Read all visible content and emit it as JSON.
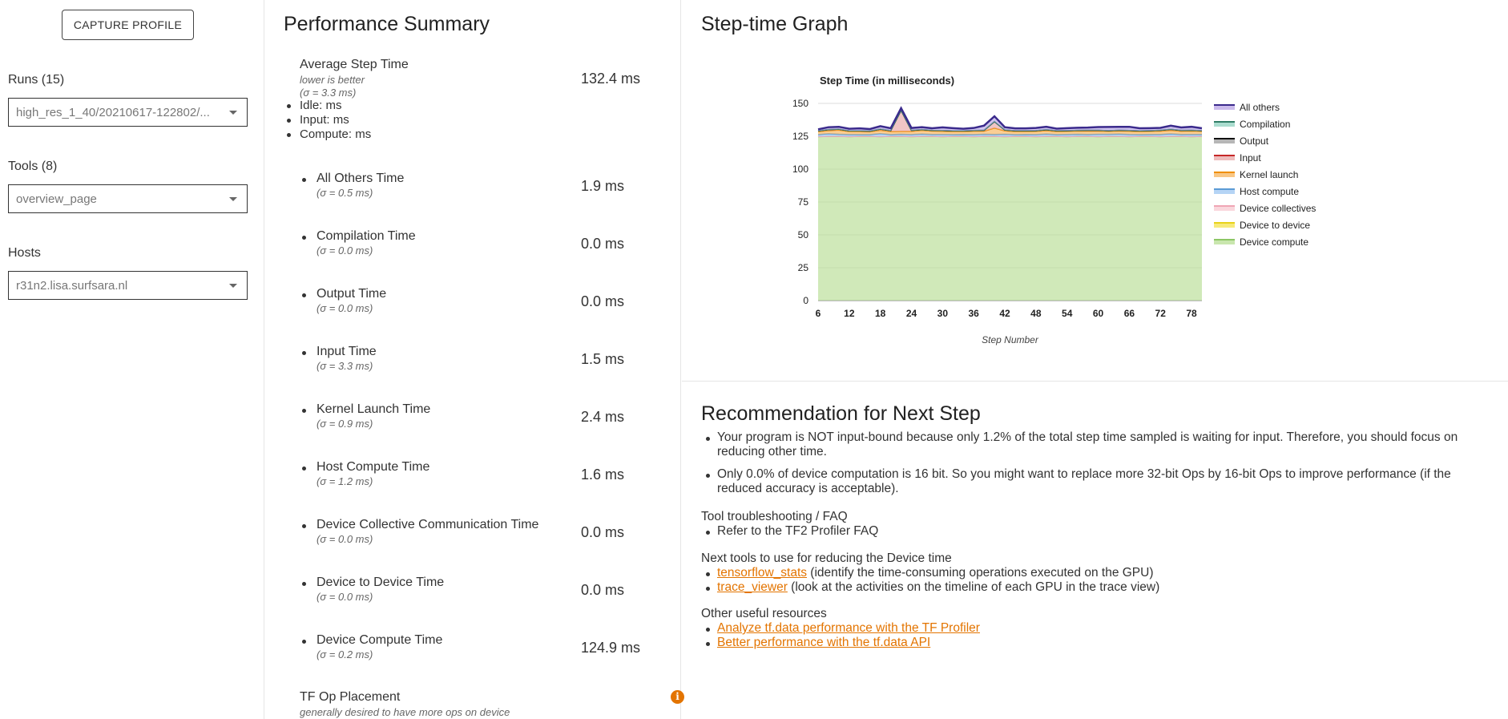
{
  "sidebar": {
    "capture_label": "CAPTURE PROFILE",
    "runs_label": "Runs (15)",
    "runs_value": "high_res_1_40/20210617-122802/...",
    "tools_label": "Tools (8)",
    "tools_value": "overview_page",
    "hosts_label": "Hosts",
    "hosts_value": "r31n2.lisa.surfsara.nl"
  },
  "summary": {
    "title": "Performance Summary",
    "average": {
      "name": "Average Step Time",
      "note": "lower is better",
      "sigma": "(σ = 3.3 ms)",
      "value": "132.4 ms",
      "breakdown": [
        "Idle: ms",
        "Input: ms",
        "Compute: ms"
      ]
    },
    "metrics": [
      {
        "name": "All Others Time",
        "sigma": "(σ = 0.5 ms)",
        "value": "1.9 ms"
      },
      {
        "name": "Compilation Time",
        "sigma": "(σ = 0.0 ms)",
        "value": "0.0 ms"
      },
      {
        "name": "Output Time",
        "sigma": "(σ = 0.0 ms)",
        "value": "0.0 ms"
      },
      {
        "name": "Input Time",
        "sigma": "(σ = 3.3 ms)",
        "value": "1.5 ms"
      },
      {
        "name": "Kernel Launch Time",
        "sigma": "(σ = 0.9 ms)",
        "value": "2.4 ms"
      },
      {
        "name": "Host Compute Time",
        "sigma": "(σ = 1.2 ms)",
        "value": "1.6 ms"
      },
      {
        "name": "Device Collective Communication Time",
        "sigma": "(σ = 0.0 ms)",
        "value": "0.0 ms"
      },
      {
        "name": "Device to Device Time",
        "sigma": "(σ = 0.0 ms)",
        "value": "0.0 ms"
      },
      {
        "name": "Device Compute Time",
        "sigma": "(σ = 0.2 ms)",
        "value": "124.9 ms"
      }
    ],
    "op_placement_title": "TF Op Placement",
    "op_placement_icon": "info-icon",
    "op_placement_desc": "generally desired to have more ops on device"
  },
  "graph": {
    "panel_title": "Step-time Graph"
  },
  "chart_data": {
    "type": "area",
    "title": "Step Time (in milliseconds)",
    "xlabel": "Step Number",
    "ylabel": "",
    "xlim": [
      6,
      80
    ],
    "ylim": [
      0,
      150
    ],
    "x_ticks": [
      6,
      12,
      18,
      24,
      30,
      36,
      42,
      48,
      54,
      60,
      66,
      72,
      78
    ],
    "y_ticks": [
      0,
      25,
      50,
      75,
      100,
      125,
      150
    ],
    "stacked": true,
    "grid": true,
    "legend_position": "right",
    "x": [
      6,
      8,
      10,
      12,
      14,
      16,
      18,
      20,
      22,
      24,
      26,
      28,
      30,
      32,
      34,
      36,
      38,
      40,
      42,
      44,
      46,
      48,
      50,
      52,
      54,
      56,
      58,
      60,
      62,
      64,
      66,
      68,
      70,
      72,
      74,
      76,
      78,
      80
    ],
    "series": [
      {
        "name": "Device compute",
        "color": "#b7dd93",
        "values": [
          124.8,
          124.9,
          124.9,
          124.8,
          124.9,
          124.9,
          124.8,
          124.9,
          124.9,
          124.8,
          124.9,
          124.9,
          124.8,
          124.9,
          124.9,
          124.8,
          124.9,
          124.9,
          124.8,
          124.9,
          124.9,
          124.8,
          124.9,
          124.9,
          124.8,
          124.9,
          124.9,
          124.8,
          124.9,
          124.9,
          124.8,
          124.9,
          124.9,
          124.8,
          124.9,
          124.9,
          124.8,
          124.9
        ]
      },
      {
        "name": "Device to device",
        "color": "#f4e34c",
        "values": [
          0,
          0,
          0,
          0,
          0,
          0,
          0,
          0,
          0,
          0,
          0,
          0,
          0,
          0,
          0,
          0,
          0,
          0,
          0,
          0,
          0,
          0,
          0,
          0,
          0,
          0,
          0,
          0,
          0,
          0,
          0,
          0,
          0,
          0,
          0,
          0,
          0,
          0
        ]
      },
      {
        "name": "Device collectives",
        "color": "#f8c9d2",
        "values": [
          0,
          0,
          0,
          0,
          0,
          0,
          0,
          0,
          0,
          0,
          0,
          0,
          0,
          0,
          0,
          0,
          0,
          0,
          0,
          0,
          0,
          0,
          0,
          0,
          0,
          0,
          0,
          0,
          0,
          0,
          0,
          0,
          0,
          0,
          0,
          0,
          0,
          0
        ]
      },
      {
        "name": "Host compute",
        "color": "#9cc6f2",
        "values": [
          1.5,
          2.0,
          1.6,
          1.5,
          1.4,
          1.4,
          2.2,
          1.4,
          1.6,
          1.5,
          1.8,
          1.5,
          1.6,
          1.4,
          1.5,
          1.5,
          1.6,
          1.5,
          1.7,
          1.4,
          1.5,
          1.5,
          1.8,
          1.4,
          1.6,
          1.6,
          1.5,
          1.7,
          1.6,
          1.8,
          1.6,
          1.4,
          1.5,
          1.6,
          1.9,
          1.5,
          1.6,
          1.5
        ]
      },
      {
        "name": "Kernel launch",
        "color": "#f7b45c",
        "values": [
          2.2,
          2.4,
          3.2,
          2.3,
          2.2,
          2.1,
          2.6,
          2.3,
          2.2,
          2.4,
          2.8,
          2.6,
          2.3,
          2.2,
          2.1,
          2.5,
          2.4,
          4.8,
          2.6,
          2.3,
          2.2,
          2.4,
          2.6,
          2.3,
          2.3,
          2.4,
          2.5,
          2.4,
          2.2,
          2.3,
          2.4,
          2.2,
          2.3,
          2.5,
          2.7,
          2.4,
          2.6,
          2.3
        ]
      },
      {
        "name": "Input",
        "color": "#e8a6a6",
        "values": [
          0.6,
          0.8,
          0.7,
          0.5,
          0.6,
          0.6,
          0.9,
          0.7,
          16.0,
          0.8,
          0.6,
          0.5,
          0.7,
          0.6,
          0.6,
          0.6,
          0.7,
          5.0,
          0.7,
          0.6,
          0.6,
          0.6,
          0.7,
          0.6,
          0.6,
          0.6,
          0.7,
          0.7,
          0.6,
          0.6,
          0.6,
          0.6,
          0.6,
          0.7,
          0.8,
          0.7,
          0.6,
          0.6
        ]
      },
      {
        "name": "Output",
        "color": "#9e9e9e",
        "values": [
          0,
          0,
          0,
          0,
          0,
          0,
          0,
          0,
          0,
          0,
          0,
          0,
          0,
          0,
          0,
          0,
          0,
          0,
          0,
          0,
          0,
          0,
          0,
          0,
          0,
          0,
          0,
          0,
          0,
          0,
          0,
          0,
          0,
          0,
          0,
          0,
          0,
          0
        ]
      },
      {
        "name": "Compilation",
        "color": "#8fd1bf",
        "values": [
          0,
          0,
          0,
          0,
          0,
          0,
          0,
          0,
          0,
          0,
          0,
          0,
          0,
          0,
          0,
          0,
          0,
          0,
          0,
          0,
          0,
          0,
          0,
          0,
          0,
          0,
          0,
          0,
          0,
          0,
          0,
          0,
          0,
          0,
          0,
          0,
          0,
          0
        ]
      },
      {
        "name": "All others",
        "color": "#b9a4e6",
        "values": [
          1.2,
          1.8,
          1.8,
          1.6,
          1.9,
          1.5,
          2.2,
          1.8,
          1.7,
          1.8,
          1.8,
          1.6,
          2.4,
          2.1,
          1.6,
          1.9,
          3.5,
          4.0,
          2.1,
          1.8,
          1.8,
          2.0,
          2.2,
          1.6,
          1.9,
          2.0,
          2.0,
          2.4,
          2.8,
          2.6,
          2.8,
          2.0,
          1.9,
          1.8,
          2.8,
          2.2,
          2.6,
          1.8
        ]
      }
    ],
    "line_colors": {
      "All others": "#3a2a8c",
      "Compilation": "#2f7d66",
      "Output": "#111111",
      "Input": "#c62828",
      "Kernel launch": "#ef8f00",
      "Host compute": "#5b9bd5",
      "Device collectives": "#f0a5b5",
      "Device to device": "#e8d21a",
      "Device compute": "#8cc665"
    }
  },
  "recommendation": {
    "title": "Recommendation for Next Step",
    "bullets": [
      "Your program is NOT input-bound because only 1.2% of the total step time sampled is waiting for input. Therefore, you should focus on reducing other time.",
      "Only 0.0% of device computation is 16 bit. So you might want to replace more 32-bit Ops by 16-bit Ops to improve performance (if the reduced accuracy is acceptable)."
    ],
    "faq_head": "Tool troubleshooting / FAQ",
    "faq_item": "Refer to the TF2 Profiler FAQ",
    "next_head": "Next tools to use for reducing the Device time",
    "next_tools": [
      {
        "link": "tensorflow_stats",
        "desc": " (identify the time-consuming operations executed on the GPU)"
      },
      {
        "link": "trace_viewer",
        "desc": " (look at the activities on the timeline of each GPU in the trace view)"
      }
    ],
    "resources_head": "Other useful resources",
    "resources": [
      "Analyze tf.data performance with the TF Profiler",
      "Better performance with the tf.data API"
    ]
  }
}
